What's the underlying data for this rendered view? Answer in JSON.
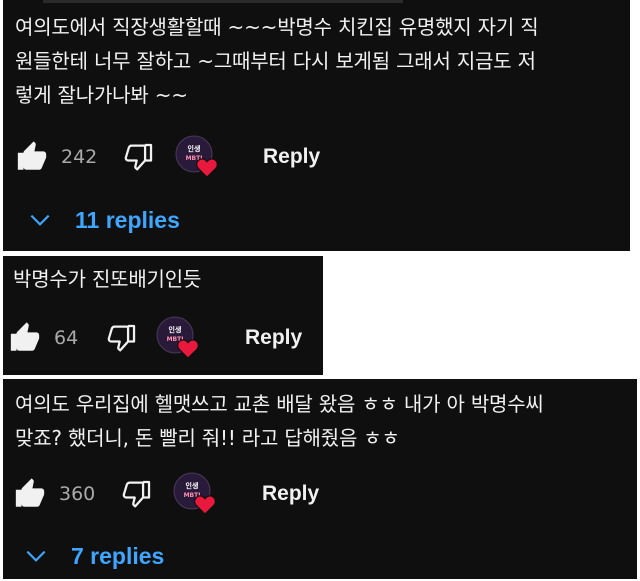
{
  "colors": {
    "background": "#0f0f0f",
    "text": "#f1f1f1",
    "muted": "#aaaaaa",
    "link": "#3ea6ff",
    "heart": "#e8193d"
  },
  "comments": [
    {
      "text": "여의도에서 직장생활할때 ~~~박명수 치킨집 유명했지 자기 직\n원들한테  너무 잘하고 ~그때부터 다시 보게됨 그래서 지금도 저\n렇게 잘나가나봐 ~~",
      "likes": "242",
      "reply_label": "Reply",
      "replies_label": "11 replies",
      "creator_heart_icon": "creator-heart-avatar"
    },
    {
      "text": "박명수가 진또배기인듯",
      "likes": "64",
      "reply_label": "Reply",
      "creator_heart_icon": "creator-heart-avatar"
    },
    {
      "text": "여의도 우리집에 헬맷쓰고 교촌 배달 왔음 ㅎㅎ 내가 아 박명수씨\n맞죠? 했더니, 돈 빨리 줘!! 라고 답해줬음 ㅎㅎ",
      "likes": "360",
      "reply_label": "Reply",
      "replies_label": "7 replies",
      "creator_heart_icon": "creator-heart-avatar"
    }
  ]
}
